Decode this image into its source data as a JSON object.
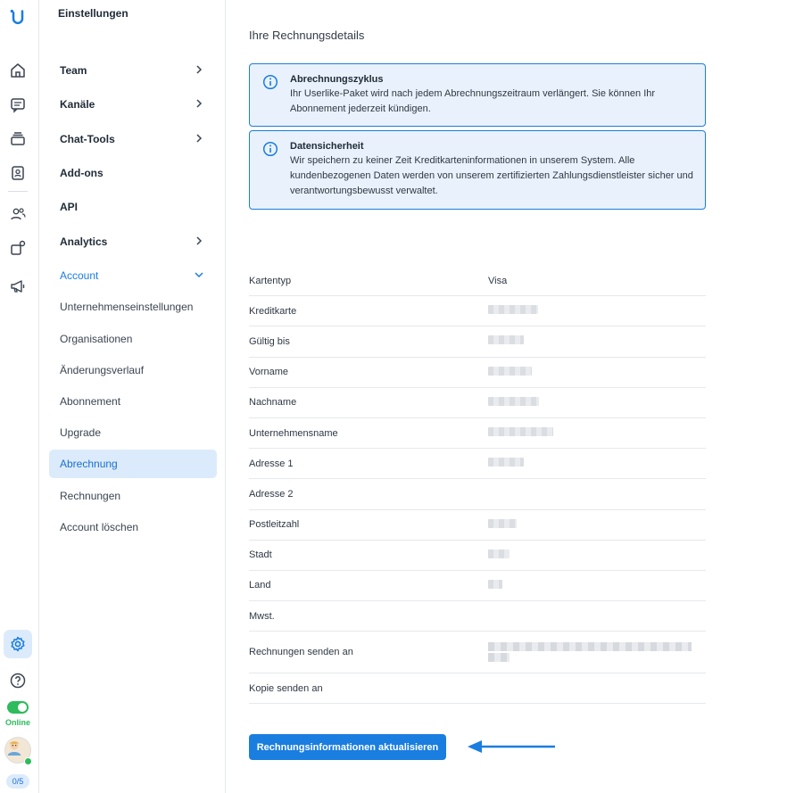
{
  "rail": {
    "status_label": "Online",
    "counter": "0/5"
  },
  "nav": {
    "title": "Einstellungen",
    "items": [
      {
        "label": "Team",
        "chevron": "right"
      },
      {
        "label": "Kanäle",
        "chevron": "right"
      },
      {
        "label": "Chat-Tools",
        "chevron": "right"
      },
      {
        "label": "Add-ons"
      },
      {
        "label": "API"
      },
      {
        "label": "Analytics",
        "chevron": "right"
      },
      {
        "label": "Account",
        "chevron": "down"
      }
    ],
    "account_subitems": [
      "Unternehmenseinstellungen",
      "Organisationen",
      "Änderungsverlauf",
      "Abonnement",
      "Upgrade",
      "Abrechnung",
      "Rechnungen",
      "Account löschen"
    ],
    "active_subitem": "Abrechnung"
  },
  "main": {
    "heading": "Ihre Rechnungsdetails",
    "info_boxes": [
      {
        "title": "Abrechnungszyklus",
        "body": "Ihr Userlike-Paket wird nach jedem Abrechnungszeitraum verlängert. Sie können Ihr Abonnement jederzeit kündigen."
      },
      {
        "title": "Datensicherheit",
        "body": "Wir speichern zu keiner Zeit Kreditkarteninformationen in unserem System. Alle kundenbezogenen Daten werden von unserem zertifizierten Zahlungsdienstleister sicher und verantwortungsbewusst verwaltet."
      }
    ],
    "rows": [
      {
        "label": "Kartentyp",
        "value": "Visa"
      },
      {
        "label": "Kreditkarte"
      },
      {
        "label": "Gültig bis"
      },
      {
        "label": "Vorname"
      },
      {
        "label": "Nachname"
      },
      {
        "label": "Unternehmensname"
      },
      {
        "label": "Adresse 1"
      },
      {
        "label": "Adresse 2"
      },
      {
        "label": "Postleitzahl"
      },
      {
        "label": "Stadt"
      },
      {
        "label": "Land"
      },
      {
        "label": "Mwst."
      },
      {
        "label": "Rechnungen senden an"
      },
      {
        "label": "Kopie senden an"
      }
    ],
    "update_button": "Rechnungsinformationen aktualisieren"
  },
  "colors": {
    "accent": "#1a7de0",
    "active_bg": "#dcebfb",
    "info_bg": "#e9f2fc",
    "online": "#2dbb5c"
  }
}
